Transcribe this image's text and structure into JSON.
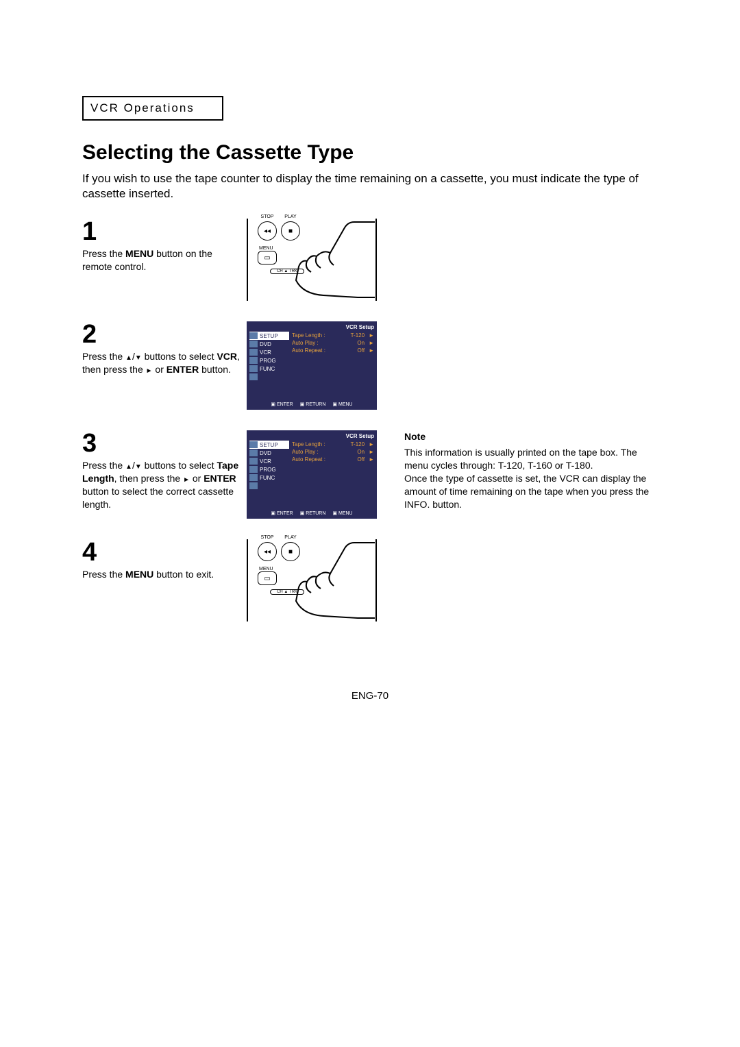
{
  "section_label": "VCR Operations",
  "title": "Selecting the Cassette Type",
  "intro": "If you wish to use the tape counter to display the time remaining on a cassette, you must indicate the type of cassette inserted.",
  "steps": {
    "s1": {
      "num": "1",
      "text_pre": "Press the ",
      "text_b1": "MENU",
      "text_post": " button on the remote control."
    },
    "s2": {
      "num": "2",
      "t1": "Press the ",
      "t2": " buttons to select ",
      "b1": "VCR",
      "t3": ", then press the ",
      "t4": " or ",
      "b2": "ENTER",
      "t5": " button."
    },
    "s3": {
      "num": "3",
      "t1": "Press the ",
      "t2": " buttons to select ",
      "b1": "Tape Length",
      "t3": ", then press the ",
      "t4": " or ",
      "b2": "ENTER",
      "t5": " button to select the correct cassette length."
    },
    "s4": {
      "num": "4",
      "t1": "Press the ",
      "b1": "MENU",
      "t2": " button to exit."
    }
  },
  "note": {
    "title": "Note",
    "p1": "This information is usually printed on the tape box. The menu cycles through: T-120, T-160 or T-180.",
    "p2": "Once the type of cassette is set, the VCR can display the amount of time remaining on the tape when you press the INFO. button."
  },
  "remote": {
    "stop": "STOP",
    "play": "PLAY",
    "menu": "MENU",
    "chtrk": "CH ▲ TRK"
  },
  "osd": {
    "header": "VCR Setup",
    "left": [
      "SETUP",
      "DVD",
      "VCR",
      "PROG",
      "FUNC"
    ],
    "rows": [
      {
        "label": "Tape Length :",
        "val": "T-120"
      },
      {
        "label": "Auto Play :",
        "val": "On"
      },
      {
        "label": "Auto Repeat :",
        "val": "Off"
      }
    ],
    "footer": [
      "ENTER",
      "RETURN",
      "MENU"
    ]
  },
  "page_num": "ENG-70"
}
